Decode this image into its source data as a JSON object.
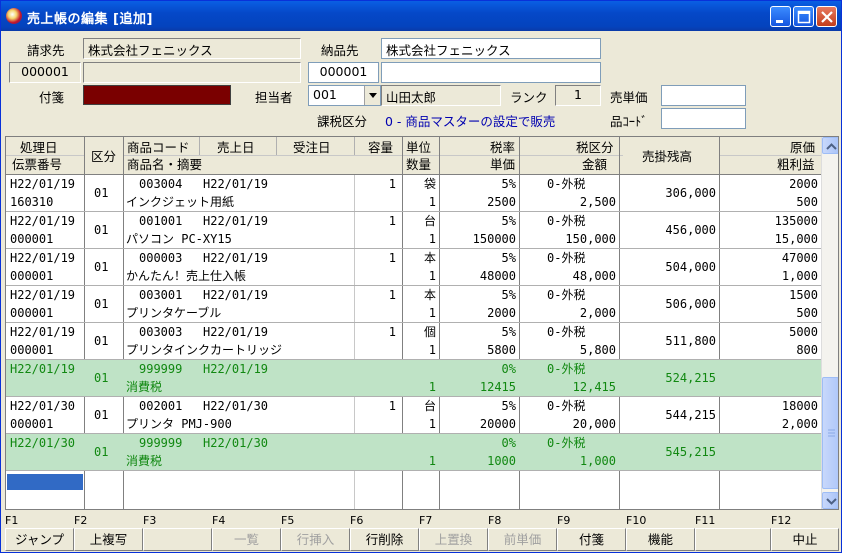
{
  "window": {
    "title": "売上帳の編集 [追加]"
  },
  "form": {
    "billto_label": "請求先",
    "billto_name": "株式会社フェニックス",
    "billto_code": "000001",
    "shipto_label": "納品先",
    "shipto_name": "株式会社フェニックス",
    "shipto_code": "000001",
    "tag_label": "付箋",
    "staff_label": "担当者",
    "staff_code": "001",
    "staff_name": "山田太郎",
    "rank_label": "ランク",
    "rank_value": "1",
    "unit_price_label": "売単価",
    "unit_price_value": "",
    "tax_label": "課税区分",
    "tax_value": "0 - 商品マスターの設定で販売",
    "item_code_label": "品ｺｰﾄﾞ",
    "item_code_value": ""
  },
  "grid": {
    "headers": {
      "proc_date": "処理日",
      "slip_no": "伝票番号",
      "kubun": "区分",
      "item_code": "商品コード",
      "sales_date": "売上日",
      "order_date": "受注日",
      "item_name": "商品名・摘要",
      "capacity": "容量",
      "unit": "単位",
      "qty": "数量",
      "tax_rate": "税率",
      "unit_price": "単価",
      "tax_class": "税区分",
      "amount": "金額",
      "receivable": "売掛残高",
      "cost": "原価",
      "gross_profit": "粗利益"
    },
    "rows": [
      {
        "date": "H22/01/19",
        "slip": "160310",
        "kubun": "01",
        "code": "003004",
        "sdate": "H22/01/19",
        "name": "インクジェット用紙",
        "cap": "1",
        "unit": "袋",
        "qty": "1",
        "rate": "5%",
        "price": "2500",
        "tclass": "0-外税",
        "amount": "2,500",
        "recv": "306,000",
        "cost": "2000",
        "profit": "500",
        "green": false
      },
      {
        "date": "H22/01/19",
        "slip": "000001",
        "kubun": "01",
        "code": "001001",
        "sdate": "H22/01/19",
        "name": "パソコン PC-XY15",
        "cap": "1",
        "unit": "台",
        "qty": "1",
        "rate": "5%",
        "price": "150000",
        "tclass": "0-外税",
        "amount": "150,000",
        "recv": "456,000",
        "cost": "135000",
        "profit": "15,000",
        "green": false
      },
      {
        "date": "H22/01/19",
        "slip": "000001",
        "kubun": "01",
        "code": "000003",
        "sdate": "H22/01/19",
        "name": "かんたん！売上仕入帳",
        "cap": "1",
        "unit": "本",
        "qty": "1",
        "rate": "5%",
        "price": "48000",
        "tclass": "0-外税",
        "amount": "48,000",
        "recv": "504,000",
        "cost": "47000",
        "profit": "1,000",
        "green": false
      },
      {
        "date": "H22/01/19",
        "slip": "000001",
        "kubun": "01",
        "code": "003001",
        "sdate": "H22/01/19",
        "name": "プリンタケーブル",
        "cap": "1",
        "unit": "本",
        "qty": "1",
        "rate": "5%",
        "price": "2000",
        "tclass": "0-外税",
        "amount": "2,000",
        "recv": "506,000",
        "cost": "1500",
        "profit": "500",
        "green": false
      },
      {
        "date": "H22/01/19",
        "slip": "000001",
        "kubun": "01",
        "code": "003003",
        "sdate": "H22/01/19",
        "name": "プリンタインクカートリッジ",
        "cap": "1",
        "unit": "個",
        "qty": "1",
        "rate": "5%",
        "price": "5800",
        "tclass": "0-外税",
        "amount": "5,800",
        "recv": "511,800",
        "cost": "5000",
        "profit": "800",
        "green": false
      },
      {
        "date": "H22/01/19",
        "slip": "",
        "kubun": "01",
        "code": "999999",
        "sdate": "H22/01/19",
        "name": "消費税",
        "cap": "",
        "unit": "",
        "qty": "1",
        "rate": "0%",
        "price": "12415",
        "tclass": "0-外税",
        "amount": "12,415",
        "recv": "524,215",
        "cost": "",
        "profit": "",
        "green": true
      },
      {
        "date": "H22/01/30",
        "slip": "000001",
        "kubun": "01",
        "code": "002001",
        "sdate": "H22/01/30",
        "name": "プリンタ PMJ-900",
        "cap": "1",
        "unit": "台",
        "qty": "1",
        "rate": "5%",
        "price": "20000",
        "tclass": "0-外税",
        "amount": "20,000",
        "recv": "544,215",
        "cost": "18000",
        "profit": "2,000",
        "green": false
      },
      {
        "date": "H22/01/30",
        "slip": "",
        "kubun": "01",
        "code": "999999",
        "sdate": "H22/01/30",
        "name": "消費税",
        "cap": "",
        "unit": "",
        "qty": "1",
        "rate": "0%",
        "price": "1000",
        "tclass": "0-外税",
        "amount": "1,000",
        "recv": "545,215",
        "cost": "",
        "profit": "",
        "green": true
      }
    ]
  },
  "fkeys": [
    {
      "key": "F1",
      "label": "ジャンプ",
      "enabled": true
    },
    {
      "key": "F2",
      "label": "上複写",
      "enabled": true
    },
    {
      "key": "F3",
      "label": "",
      "enabled": true
    },
    {
      "key": "F4",
      "label": "一覧",
      "enabled": false
    },
    {
      "key": "F5",
      "label": "行挿入",
      "enabled": false
    },
    {
      "key": "F6",
      "label": "行削除",
      "enabled": true
    },
    {
      "key": "F7",
      "label": "上置換",
      "enabled": false
    },
    {
      "key": "F8",
      "label": "前単価",
      "enabled": false
    },
    {
      "key": "F9",
      "label": "付箋",
      "enabled": true
    },
    {
      "key": "F10",
      "label": "機能",
      "enabled": true
    },
    {
      "key": "F11",
      "label": "",
      "enabled": true
    },
    {
      "key": "F12",
      "label": "中止",
      "enabled": true
    }
  ],
  "colors": {
    "title_bar": "#0548c8",
    "tag_color": "#7a0000",
    "tax_row_bg": "#bfe3c6",
    "tax_row_text": "#118811",
    "selection": "#316ac5"
  }
}
